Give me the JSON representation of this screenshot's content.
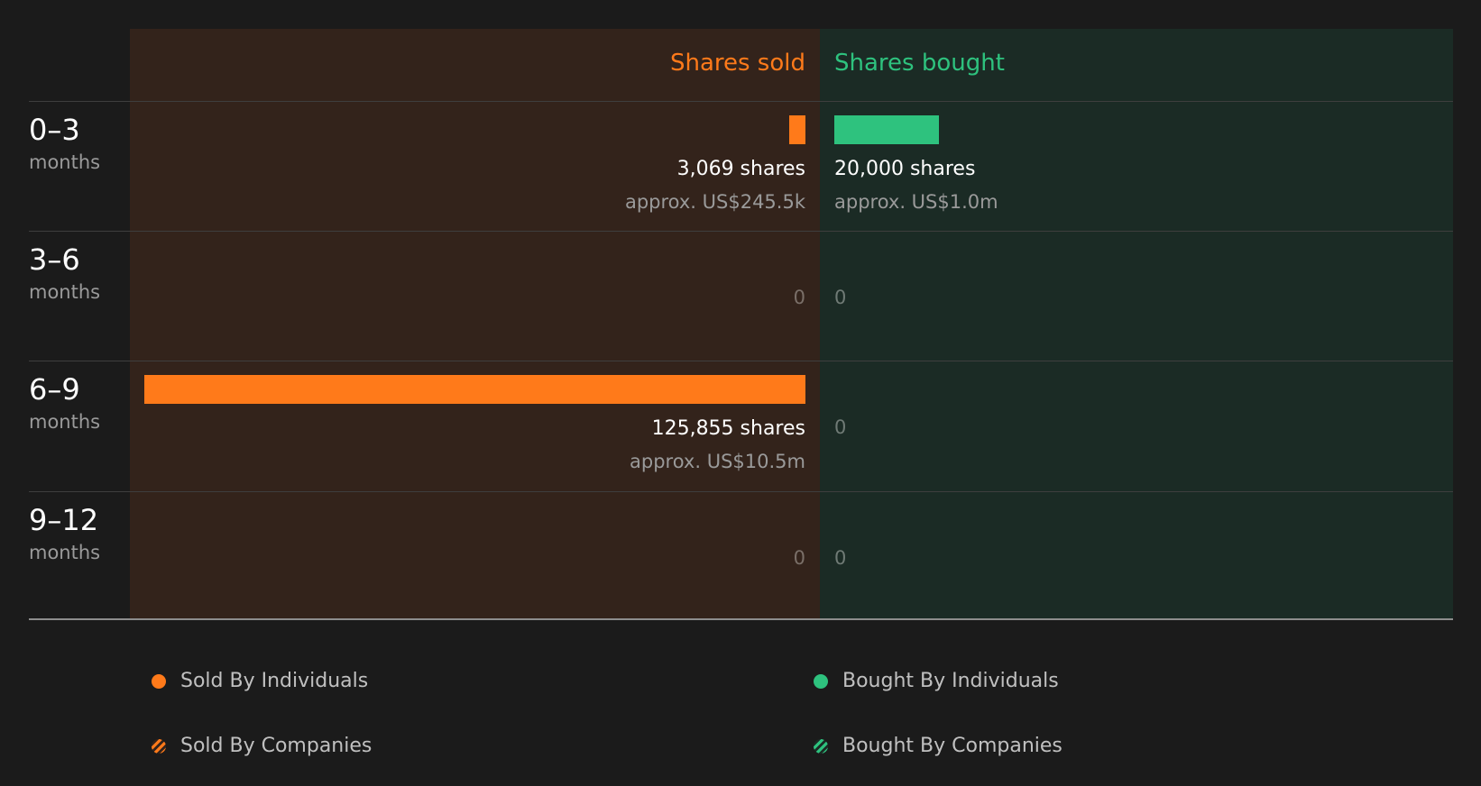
{
  "chart_data": {
    "type": "bar",
    "orientation": "horizontal-diverging",
    "columns": {
      "sold": "Shares sold",
      "bought": "Shares bought"
    },
    "categories": [
      {
        "range": "0–3",
        "unit": "months"
      },
      {
        "range": "3–6",
        "unit": "months"
      },
      {
        "range": "6–9",
        "unit": "months"
      },
      {
        "range": "9–12",
        "unit": "months"
      }
    ],
    "series": [
      {
        "name": "Shares sold",
        "values": [
          3069,
          0,
          125855,
          0
        ],
        "labels": [
          "3,069 shares",
          "0",
          "125,855 shares",
          "0"
        ],
        "approx": [
          "approx. US$245.5k",
          "",
          "approx. US$10.5m",
          ""
        ]
      },
      {
        "name": "Shares bought",
        "values": [
          20000,
          0,
          0,
          0
        ],
        "labels": [
          "20,000 shares",
          "0",
          "0",
          "0"
        ],
        "approx": [
          "approx. US$1.0m",
          "",
          "",
          ""
        ]
      }
    ],
    "xlim": [
      0,
      125855
    ],
    "colors": {
      "sold": "#ff7a1a",
      "bought": "#2ec27e"
    },
    "legend": {
      "placement": "bottom",
      "items": [
        {
          "label": "Sold By Individuals",
          "style": "solid-sold"
        },
        {
          "label": "Bought By Individuals",
          "style": "solid-bought"
        },
        {
          "label": "Sold By Companies",
          "style": "hatch-sold"
        },
        {
          "label": "Bought By Companies",
          "style": "hatch-bought"
        }
      ]
    }
  }
}
